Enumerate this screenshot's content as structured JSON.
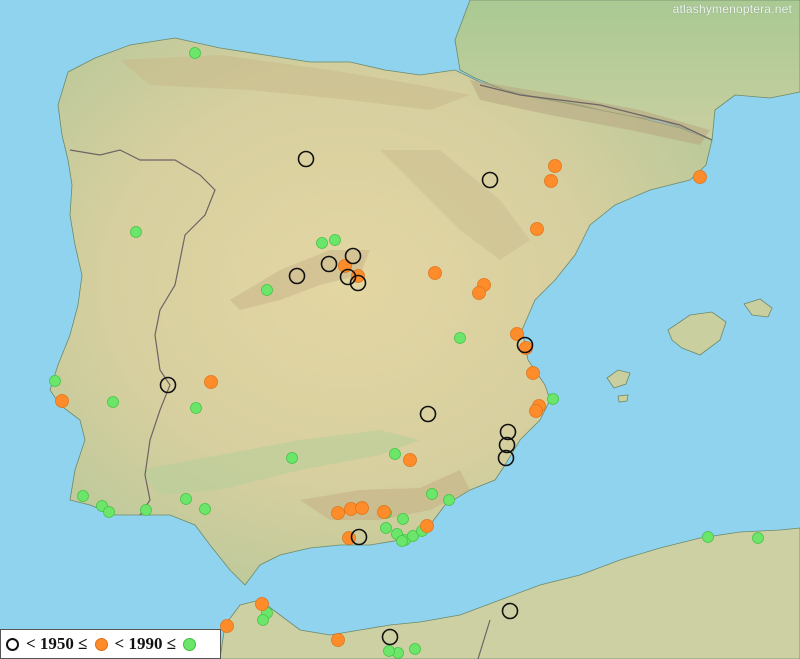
{
  "watermark": "atlashymenoptera.net",
  "legend": {
    "label_1950": "< 1950 ≤",
    "label_1990": "< 1990 ≤"
  },
  "colors": {
    "sea": "#8fd3ef",
    "land": "#d8d0a0",
    "border": "#7a6a6a",
    "old": "#111111",
    "mid": "#ff8c2a",
    "new": "#6be66b"
  },
  "records": {
    "pre1950": [
      [
        306,
        159
      ],
      [
        490,
        180
      ],
      [
        353,
        256
      ],
      [
        329,
        264
      ],
      [
        297,
        276
      ],
      [
        348,
        277
      ],
      [
        358,
        283
      ],
      [
        168,
        385
      ],
      [
        428,
        414
      ],
      [
        508,
        432
      ],
      [
        507,
        445
      ],
      [
        506,
        458
      ],
      [
        359,
        537
      ],
      [
        510,
        611
      ],
      [
        390,
        637
      ],
      [
        525,
        345
      ]
    ],
    "from1950to1990": [
      [
        555,
        166
      ],
      [
        551,
        181
      ],
      [
        700,
        177
      ],
      [
        537,
        229
      ],
      [
        345,
        266
      ],
      [
        358,
        276
      ],
      [
        435,
        273
      ],
      [
        484,
        285
      ],
      [
        479,
        293
      ],
      [
        517,
        334
      ],
      [
        526,
        348
      ],
      [
        533,
        373
      ],
      [
        539,
        406
      ],
      [
        536,
        411
      ],
      [
        211,
        382
      ],
      [
        62,
        401
      ],
      [
        410,
        460
      ],
      [
        338,
        513
      ],
      [
        351,
        509
      ],
      [
        362,
        508
      ],
      [
        384,
        512
      ],
      [
        349,
        538
      ],
      [
        427,
        526
      ],
      [
        262,
        604
      ],
      [
        227,
        626
      ],
      [
        338,
        640
      ]
    ],
    "post1990": [
      [
        195,
        53
      ],
      [
        322,
        243
      ],
      [
        335,
        240
      ],
      [
        136,
        232
      ],
      [
        267,
        290
      ],
      [
        460,
        338
      ],
      [
        55,
        381
      ],
      [
        113,
        402
      ],
      [
        196,
        408
      ],
      [
        292,
        458
      ],
      [
        395,
        454
      ],
      [
        553,
        399
      ],
      [
        432,
        494
      ],
      [
        449,
        500
      ],
      [
        83,
        496
      ],
      [
        186,
        499
      ],
      [
        102,
        506
      ],
      [
        109,
        512
      ],
      [
        146,
        510
      ],
      [
        205,
        509
      ],
      [
        386,
        513
      ],
      [
        403,
        519
      ],
      [
        386,
        528
      ],
      [
        397,
        534
      ],
      [
        405,
        540
      ],
      [
        413,
        536
      ],
      [
        422,
        531
      ],
      [
        402,
        541
      ],
      [
        708,
        537
      ],
      [
        758,
        538
      ],
      [
        267,
        613
      ],
      [
        263,
        620
      ],
      [
        415,
        649
      ],
      [
        398,
        653
      ],
      [
        389,
        651
      ]
    ]
  }
}
